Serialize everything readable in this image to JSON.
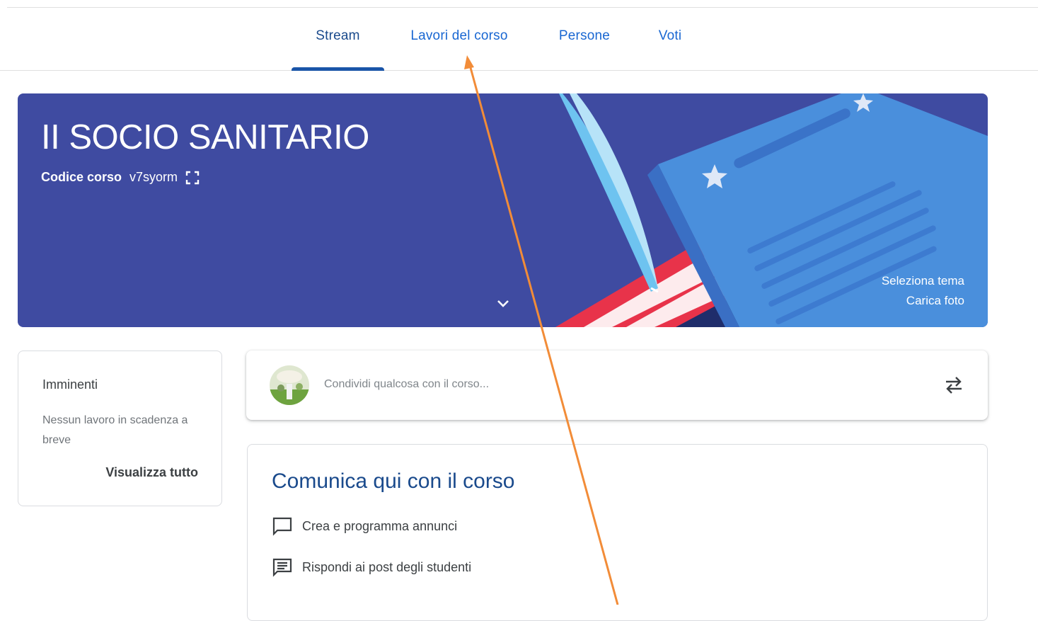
{
  "tabs": [
    {
      "label": "Stream",
      "active": true
    },
    {
      "label": "Lavori del corso",
      "active": false
    },
    {
      "label": "Persone",
      "active": false
    },
    {
      "label": "Voti",
      "active": false
    }
  ],
  "banner": {
    "title": "II SOCIO SANITARIO",
    "code_label": "Codice corso",
    "code_value": "v7syorm",
    "select_theme": "Seleziona tema",
    "upload_photo": "Carica foto",
    "background_color": "#3f4ba1"
  },
  "upcoming": {
    "title": "Imminenti",
    "empty_text": "Nessun lavoro in scadenza a breve",
    "view_all": "Visualizza tutto"
  },
  "share": {
    "placeholder": "Condividi qualcosa con il corso..."
  },
  "communicate": {
    "title": "Comunica qui con il corso",
    "items": [
      {
        "label": "Crea e programma annunci",
        "icon": "chat-bubble-icon"
      },
      {
        "label": "Rispondi ai post degli studenti",
        "icon": "message-text-icon"
      }
    ]
  },
  "colors": {
    "accent": "#1967d2",
    "title_blue": "#1a4a8c",
    "annotation_arrow": "#f28c38"
  }
}
